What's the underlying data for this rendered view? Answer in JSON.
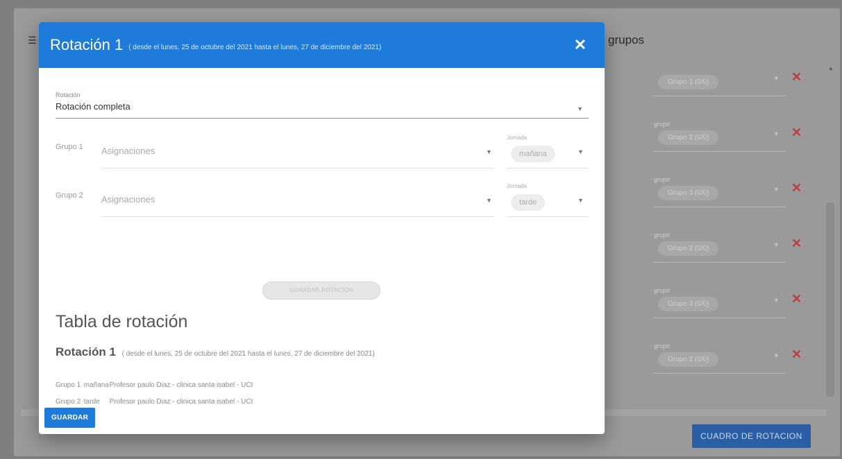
{
  "background": {
    "menu_icon": "menu-icon",
    "title": "grupos",
    "rows": [
      {
        "label": "",
        "chip": "Grupo 1 (0/0)"
      },
      {
        "label": "grupo",
        "chip": "Grupo 2 (0/0)"
      },
      {
        "label": "grupo",
        "chip": "Grupo 3 (0/0)"
      },
      {
        "label": "grupo",
        "chip": "Grupo 2 (0/0)"
      },
      {
        "label": "grupo",
        "chip": "Grupo 3 (0/0)"
      },
      {
        "label": "grupo",
        "chip": "Grupo 2 (0/0)"
      }
    ],
    "remove_symbol": "✕",
    "cuadro_button": "CUADRO DE ROTACION",
    "colors": {
      "remove": "#c03a3a",
      "button": "#2a5fa8"
    }
  },
  "dialog": {
    "title": "Rotación 1",
    "subtitle": "( desde el lunes, 25 de octubre del 2021 hasta el lunes, 27 de diciembre del 2021)",
    "close_symbol": "✕",
    "header_color": "#1e7bd9",
    "rotation_select": {
      "label": "Rotación",
      "value": "Rotación completa"
    },
    "groups": [
      {
        "name": "Grupo 1",
        "placeholder": "Asignaciones",
        "horario_label": "Jornada",
        "horario": "mañana"
      },
      {
        "name": "Grupo 2",
        "placeholder": "Asignaciones",
        "horario_label": "Jornada",
        "horario": "tarde"
      }
    ],
    "save_rotation_button": "GUARDAR ROTACION",
    "table_title": "Tabla de rotación",
    "table_rotation_title": "Rotación 1",
    "table_rotation_subtitle": "( desde el lunes, 25 de octubre del 2021 hasta el lunes, 27 de diciembre del 2021)",
    "table_rows": [
      {
        "group": "Grupo 1",
        "shift": "mañana",
        "detail": "Profesor paulo Diaz - clinica santa isabel - UCI"
      },
      {
        "group": "Grupo 2",
        "shift": "tarde",
        "detail": "Profesor paulo Diaz - clinica santa isabel - UCI"
      }
    ],
    "guardar_button": "GUARDAR"
  }
}
